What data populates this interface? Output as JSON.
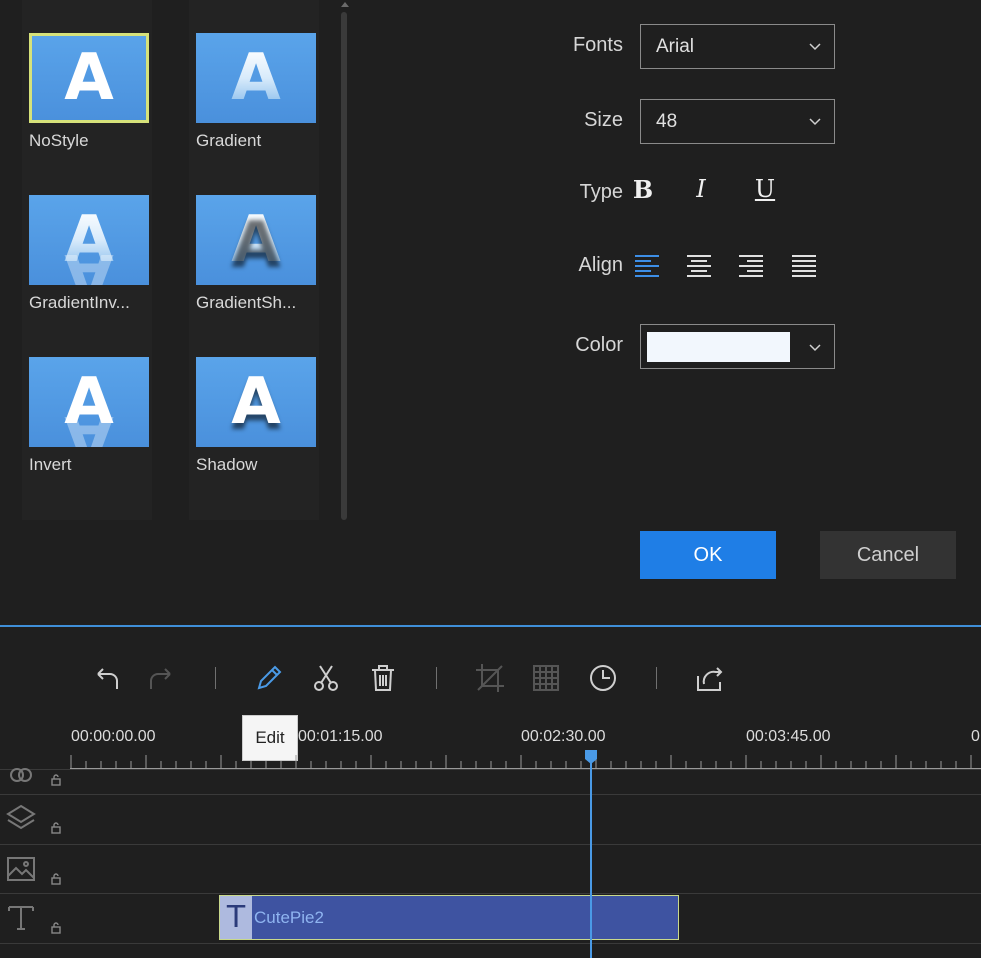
{
  "styles": [
    {
      "label": "NoStyle",
      "icon": "letter-a-plain-icon",
      "selected": true
    },
    {
      "label": "Gradient",
      "icon": "letter-a-gradient-icon"
    },
    {
      "label": "GradientInv...",
      "icon": "letter-a-gradient-invert-icon"
    },
    {
      "label": "GradientSh...",
      "icon": "letter-a-gradient-shadow-icon"
    },
    {
      "label": "Invert",
      "icon": "letter-a-invert-icon"
    },
    {
      "label": "Shadow",
      "icon": "letter-a-shadow-icon"
    }
  ],
  "thumb_glyph": "A",
  "properties": {
    "fonts_label": "Fonts",
    "fonts_value": "Arial",
    "size_label": "Size",
    "size_value": "48",
    "type_label": "Type",
    "type_bold": "B",
    "type_italic": "I",
    "type_underline": "U",
    "align_label": "Align",
    "align_options": [
      "align-left-icon",
      "align-center-icon",
      "align-right-icon",
      "align-justify-icon"
    ],
    "align_selected": "align-left-icon",
    "color_label": "Color",
    "color_value": "#f2f7fd"
  },
  "buttons": {
    "ok": "OK",
    "cancel": "Cancel"
  },
  "toolbar": {
    "tools": [
      "undo-icon",
      "redo-icon",
      "edit-icon",
      "cut-icon",
      "delete-icon",
      "crop-icon",
      "mosaic-icon",
      "duration-icon",
      "export-icon"
    ],
    "tooltip": "Edit"
  },
  "timeline": {
    "ticks": [
      "00:00:00.00",
      "00:01:15.00",
      "00:02:30.00",
      "00:03:45.00",
      "0"
    ],
    "tracks": [
      "effect-track-icon",
      "overlay-track-icon",
      "image-track-icon",
      "text-track-icon"
    ],
    "clip": {
      "label": "CutePie2",
      "icon_glyph": "T"
    }
  },
  "colors": {
    "accent": "#1f7ee6",
    "playhead": "#4a9ae6",
    "clip": "#3e53a1",
    "selected_outline": "#d6e27a"
  }
}
